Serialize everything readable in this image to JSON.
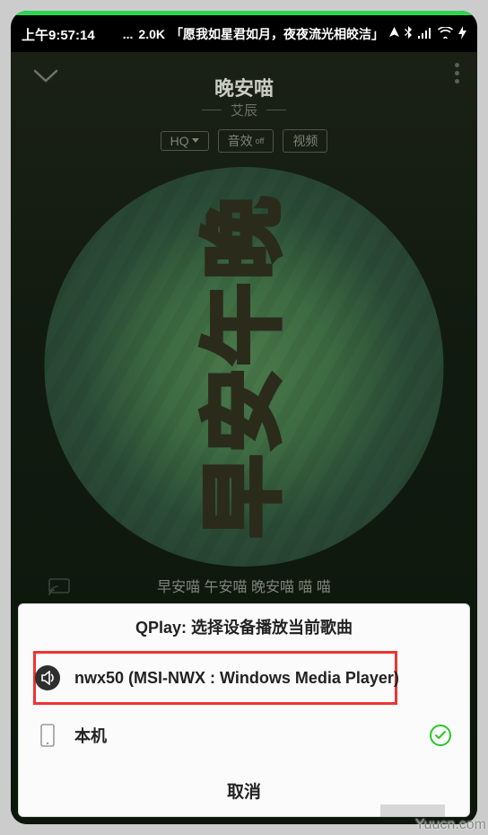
{
  "statusbar": {
    "time": "上午9:57:14",
    "speed": "2.0K",
    "marquee": "「愿我如星君如月，夜夜流光相皎洁」"
  },
  "header": {
    "title": "晚安喵",
    "artist": "艾辰"
  },
  "chips": {
    "hq": "HQ",
    "sfx_label": "音效",
    "sfx_state": "off",
    "video": "视频"
  },
  "lyric": "早安喵 午安喵 晚安喵 喵 喵",
  "sheet": {
    "title": "QPlay: 选择设备播放当前歌曲",
    "options": [
      {
        "label": "nwx50 (MSI-NWX : Windows Media Player)",
        "icon": "cast"
      },
      {
        "label": "本机",
        "icon": "phone",
        "selected": true
      }
    ],
    "cancel": "取消"
  },
  "watermark": "Yuucn.com"
}
